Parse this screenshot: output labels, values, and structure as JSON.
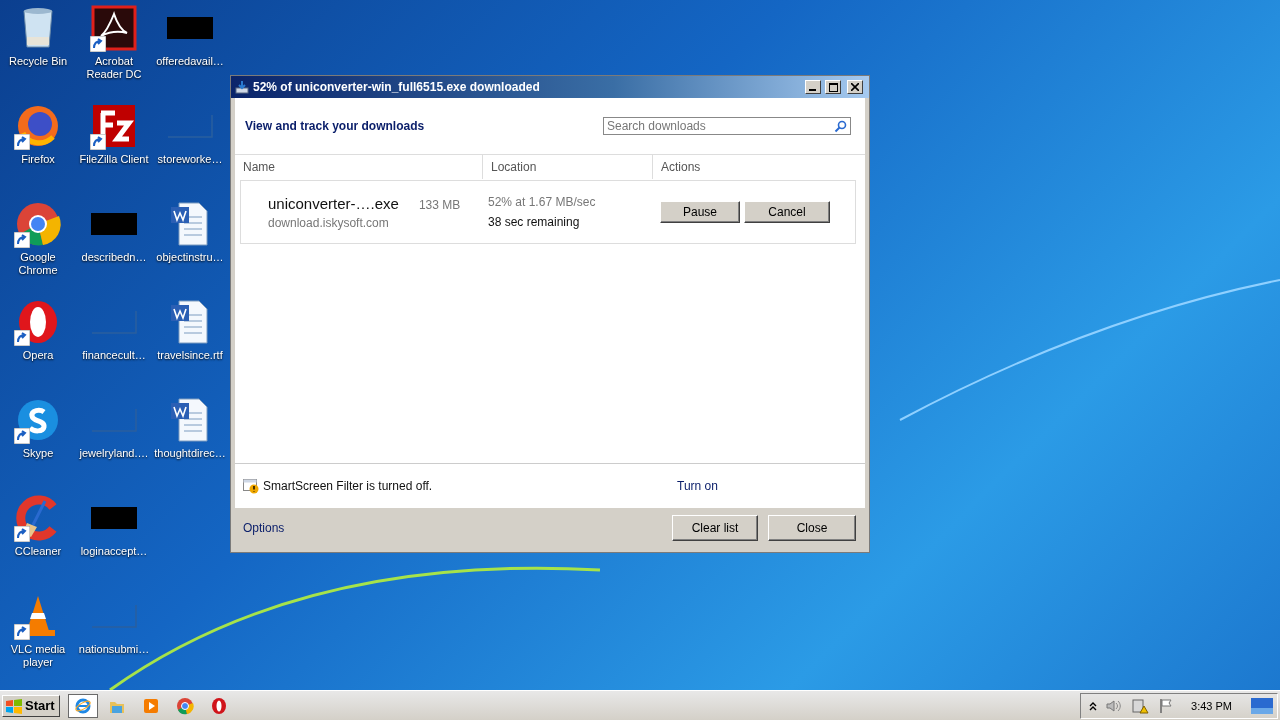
{
  "desktop": {
    "icons": [
      {
        "label": "Recycle Bin",
        "kind": "recycle",
        "shortcut": false
      },
      {
        "label": "Firefox",
        "kind": "firefox",
        "shortcut": true
      },
      {
        "label": "Google Chrome",
        "kind": "chrome",
        "shortcut": true
      },
      {
        "label": "Opera",
        "kind": "opera",
        "shortcut": true
      },
      {
        "label": "Skype",
        "kind": "skype",
        "shortcut": true
      },
      {
        "label": "CCleaner",
        "kind": "ccleaner",
        "shortcut": true
      },
      {
        "label": "VLC media player",
        "kind": "vlc",
        "shortcut": true
      },
      {
        "label": "Acrobat Reader DC",
        "kind": "acrobat",
        "shortcut": true
      },
      {
        "label": "FileZilla Client",
        "kind": "filezilla",
        "shortcut": true
      },
      {
        "label": "describedn…",
        "kind": "redacted",
        "shortcut": false
      },
      {
        "label": "financecult…",
        "kind": "blank",
        "shortcut": false
      },
      {
        "label": "jewelryland.…",
        "kind": "blank",
        "shortcut": false
      },
      {
        "label": "loginaccept…",
        "kind": "redacted",
        "shortcut": false
      },
      {
        "label": "nationsubmi…",
        "kind": "blank",
        "shortcut": false
      },
      {
        "label": "offeredavail…",
        "kind": "redacted",
        "shortcut": false
      },
      {
        "label": "storeworke…",
        "kind": "blank",
        "shortcut": false
      },
      {
        "label": "objectinstru…",
        "kind": "word",
        "shortcut": false
      },
      {
        "label": "travelsince.rtf",
        "kind": "word",
        "shortcut": false
      },
      {
        "label": "thoughtdirec…",
        "kind": "word",
        "shortcut": false
      }
    ]
  },
  "window": {
    "title": "52% of uniconverter-win_full6515.exe downloaded",
    "heading": "View and track your downloads",
    "search": {
      "placeholder": "Search downloads"
    },
    "columns": [
      "Name",
      "Location",
      "Actions"
    ],
    "downloads": [
      {
        "file": "uniconverter-….exe",
        "size": "133 MB",
        "source": "download.iskysoft.com",
        "progress": "52% at 1.67 MB/sec",
        "remaining": "38 sec remaining",
        "actions": [
          "Pause",
          "Cancel"
        ]
      }
    ],
    "smartscreen": {
      "message": "SmartScreen Filter is turned off.",
      "link": "Turn on"
    },
    "footer": {
      "link": "Options",
      "buttons": [
        "Clear list",
        "Close"
      ]
    }
  },
  "taskbar": {
    "start": "Start",
    "apps": [
      {
        "kind": "ie",
        "selected": true
      },
      {
        "kind": "folder",
        "selected": false
      },
      {
        "kind": "media",
        "selected": false
      },
      {
        "kind": "chrome",
        "selected": false
      },
      {
        "kind": "opera",
        "selected": false
      }
    ],
    "clock": "3:43 PM"
  }
}
